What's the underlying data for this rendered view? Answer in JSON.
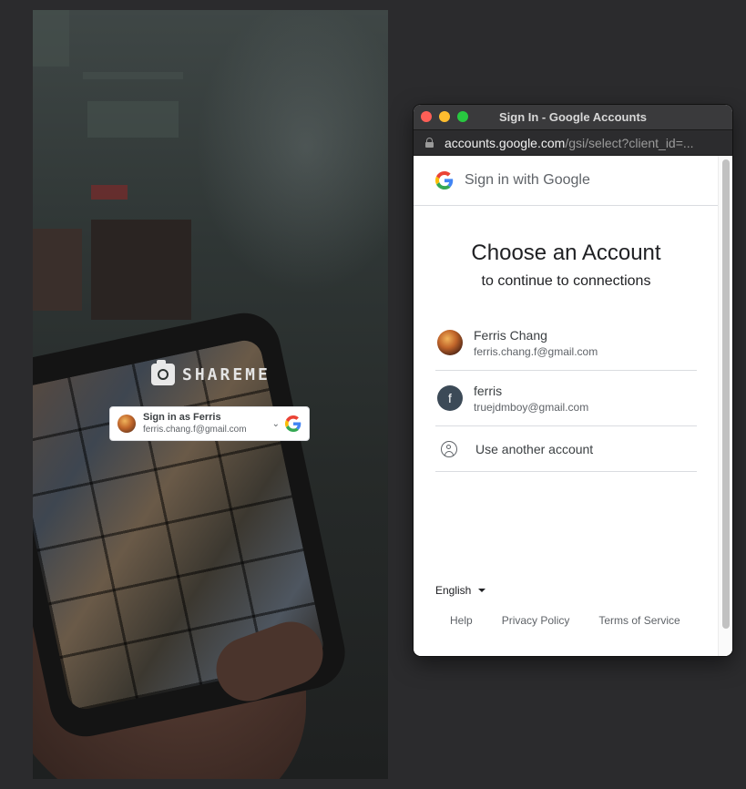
{
  "app": {
    "brand": "SHAREME",
    "gsi_button": {
      "name_line": "Sign in as Ferris",
      "email": "ferris.chang.f@gmail.com"
    }
  },
  "window": {
    "title": "Sign In - Google Accounts",
    "url_host": "accounts.google.com",
    "url_path": "/gsi/select?client_id=..."
  },
  "google": {
    "header": "Sign in with Google",
    "heading": "Choose an Account",
    "subheading": "to continue to connections",
    "accounts": [
      {
        "name": "Ferris Chang",
        "email": "ferris.chang.f@gmail.com",
        "avatar": "photo"
      },
      {
        "name": "ferris",
        "email": "truejdmboy@gmail.com",
        "avatar": "f"
      }
    ],
    "another_account": "Use another account",
    "language": "English",
    "footer": {
      "help": "Help",
      "privacy": "Privacy Policy",
      "terms": "Terms of Service"
    }
  },
  "colors": {
    "google_blue": "#4285F4",
    "google_red": "#EA4335",
    "google_yellow": "#FBBC05",
    "google_green": "#34A853"
  }
}
